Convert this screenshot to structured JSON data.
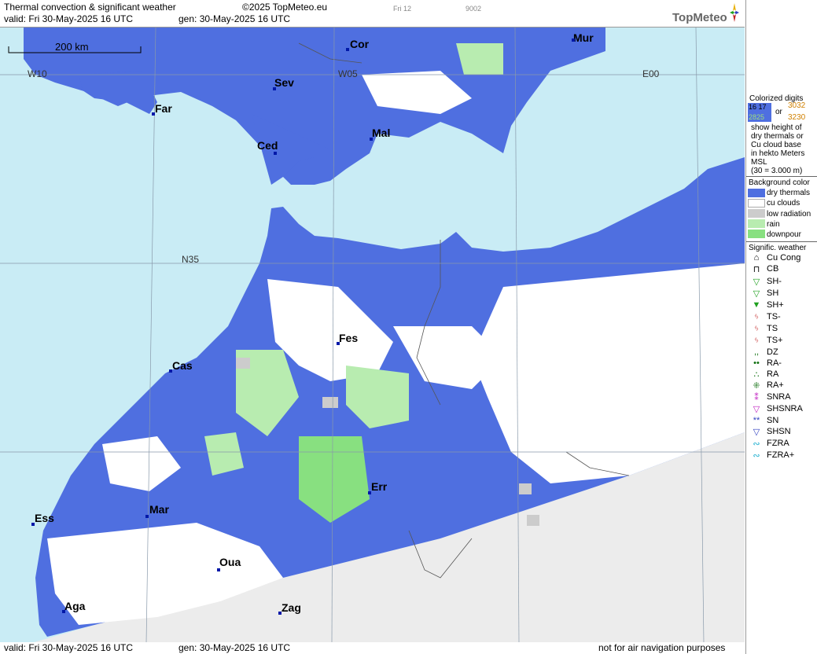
{
  "header": {
    "title": "Thermal convection & significant weather",
    "copyright": "©2025 TopMeteo.eu",
    "valid": "valid:  Fri  30-May-2025  16 UTC",
    "gen": "gen: 30-May-2025 16 UTC",
    "small1": "Fri 12",
    "small2": "9002",
    "logo": "TopMeteo"
  },
  "map": {
    "scale": "200 km",
    "grid": {
      "w10": "W10",
      "w05": "W05",
      "e00": "E00",
      "n35": "N35"
    },
    "cities": [
      "Cor",
      "Mur",
      "Far",
      "Sev",
      "Ced",
      "Mal",
      "Fes",
      "Cas",
      "Mar",
      "Ess",
      "Err",
      "Oua",
      "Aga",
      "Zag"
    ],
    "colors": {
      "dry_thermals": "#4f6fe0",
      "cu_clouds": "#ffffff",
      "low_radiation": "#cccccc",
      "rain": "#b8ecb0",
      "downpour": "#88e080",
      "sea": "#c9ecf5",
      "outside": "#ececec"
    }
  },
  "footer": {
    "valid": "valid:  Fri  30-May-2025  16 UTC",
    "gen": "gen: 30-May-2025 16 UTC",
    "note": "not for air navigation purposes"
  },
  "legend": {
    "colorized_title": "Colorized digits",
    "or": "or",
    "sample_a": "16 17",
    "sample_b": "2825",
    "sample_c": "3032",
    "sample_d": "3230",
    "desc": [
      "show height of",
      "dry thermals or",
      "Cu cloud base",
      "in hekto Meters",
      "MSL",
      "(30 = 3.000 m)"
    ],
    "background_title": "Background color",
    "bg_items": [
      "dry thermals",
      "cu clouds",
      "low radiation",
      "rain",
      "downpour"
    ],
    "signif_title": "Signific. weather",
    "wx_items": [
      "Cu Cong",
      "CB",
      "SH-",
      "SH",
      "SH+",
      "TS-",
      "TS",
      "TS+",
      "DZ",
      "RA-",
      "RA",
      "RA+",
      "SNRA",
      "SHSNRA",
      "SN",
      "SHSN",
      "FZRA",
      "FZRA+"
    ]
  }
}
